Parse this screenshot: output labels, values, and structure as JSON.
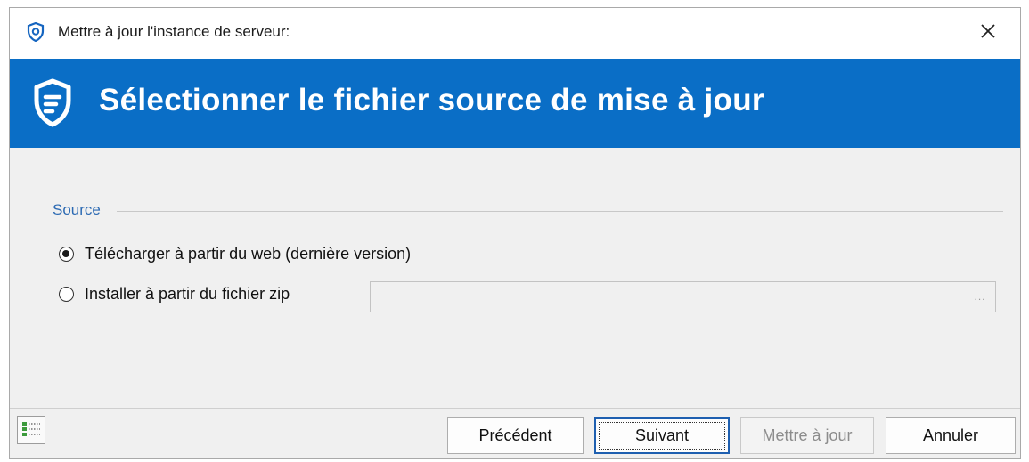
{
  "window": {
    "title": "Mettre à jour l'instance de serveur:",
    "close_label": "×"
  },
  "banner": {
    "title": "Sélectionner le fichier source de mise à jour",
    "color": "#0a6ec6"
  },
  "source": {
    "group_label": "Source",
    "options": [
      {
        "label": "Télécharger à partir du web (dernière version)",
        "selected": true
      },
      {
        "label": "Installer à partir du fichier zip",
        "selected": false
      }
    ],
    "zip_path": {
      "value": "",
      "placeholder": ""
    },
    "browse_label": "..."
  },
  "footer": {
    "buttons": {
      "previous": "Précédent",
      "next": "Suivant",
      "update": "Mettre à jour",
      "cancel": "Annuler"
    }
  },
  "icons": {
    "title": "shield-icon",
    "banner": "shield-icon",
    "footer": "checklist-icon"
  }
}
